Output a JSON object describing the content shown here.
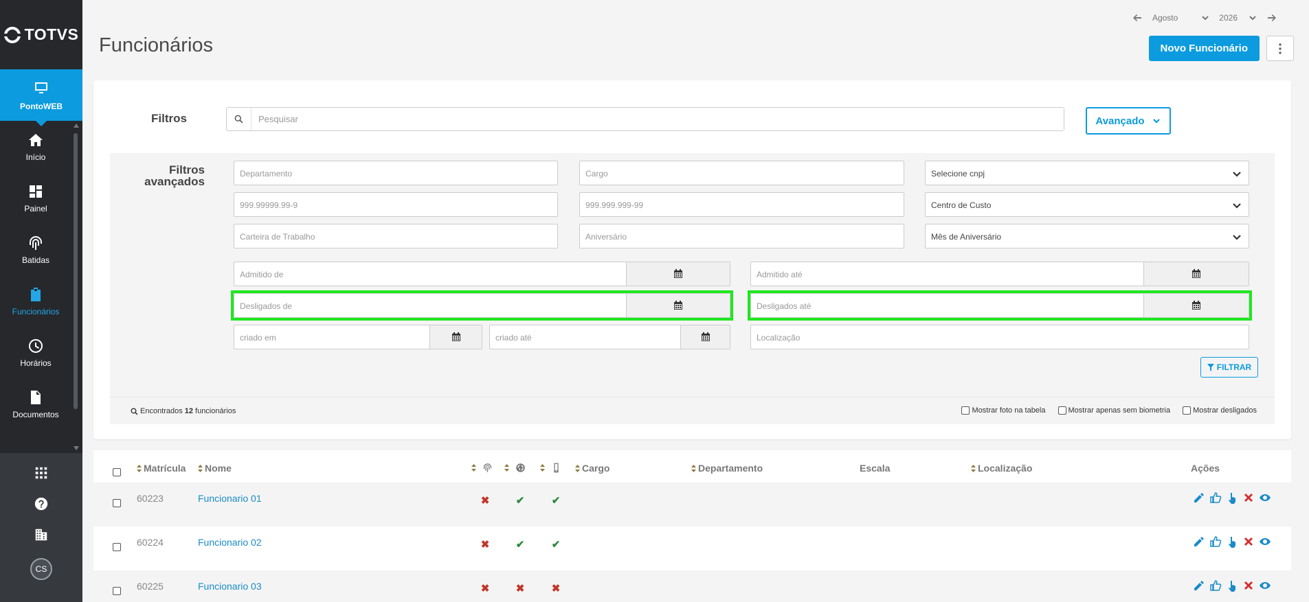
{
  "app": {
    "brand": "TOTVS",
    "module": "PontoWEB"
  },
  "sidebar": {
    "items": [
      {
        "label": "Início",
        "icon": "home-icon"
      },
      {
        "label": "Painel",
        "icon": "dashboard-icon"
      },
      {
        "label": "Batidas",
        "icon": "fingerprint-icon"
      },
      {
        "label": "Funcionários",
        "icon": "badge-icon",
        "active": true
      },
      {
        "label": "Horários",
        "icon": "clock-icon"
      },
      {
        "label": "Documentos",
        "icon": "document-icon"
      }
    ],
    "user_initials": "CS"
  },
  "header": {
    "title": "Funcionários",
    "month": "Agosto",
    "year": "2026",
    "new_button": "Novo Funcionário"
  },
  "filters": {
    "label": "Filtros",
    "search_placeholder": "Pesquisar",
    "advanced_button": "Avançado",
    "advanced_title": "Filtros avançados",
    "fields": {
      "departamento": "Departamento",
      "cargo": "Cargo",
      "cnpj": "Selecione cnpj",
      "pis": "999.99999.99-9",
      "cpf": "999.999.999-99",
      "centro_custo": "Centro de Custo",
      "carteira": "Carteira de Trabalho",
      "aniversario": "Aniversário",
      "mes_aniversario": "Mês de Aniversário",
      "admitido_de": "Admitido de",
      "admitido_ate": "Admitido até",
      "desligados_de": "Desligados de",
      "desligados_ate": "Desligados até",
      "criado_em": "criado em",
      "criado_ate": "criado até",
      "localizacao": "Localização"
    },
    "filter_button": "FILTRAR",
    "found_prefix": "Encontrados",
    "found_count": "12",
    "found_suffix": "funcionários",
    "options": [
      "Mostrar foto na tabela",
      "Mostrar apenas sem biometria",
      "Mostrar desligados"
    ]
  },
  "table": {
    "headers": {
      "matricula": "Matrícula",
      "nome": "Nome",
      "cargo": "Cargo",
      "departamento": "Departamento",
      "escala": "Escala",
      "localizacao": "Localização",
      "acoes": "Ações"
    },
    "rows": [
      {
        "matricula": "60223",
        "nome": "Funcionario 01",
        "biometria": false,
        "web": true,
        "mobile": true
      },
      {
        "matricula": "60224",
        "nome": "Funcionario 02",
        "biometria": false,
        "web": true,
        "mobile": true
      },
      {
        "matricula": "60225",
        "nome": "Funcionario 03",
        "biometria": false,
        "web": false,
        "mobile": false
      }
    ]
  },
  "colors": {
    "accent": "#0c9bde",
    "sidebar": "#26282c",
    "highlight": "#1ee81e",
    "status_no": "#c0392b",
    "status_yes": "#2e8b3e"
  }
}
